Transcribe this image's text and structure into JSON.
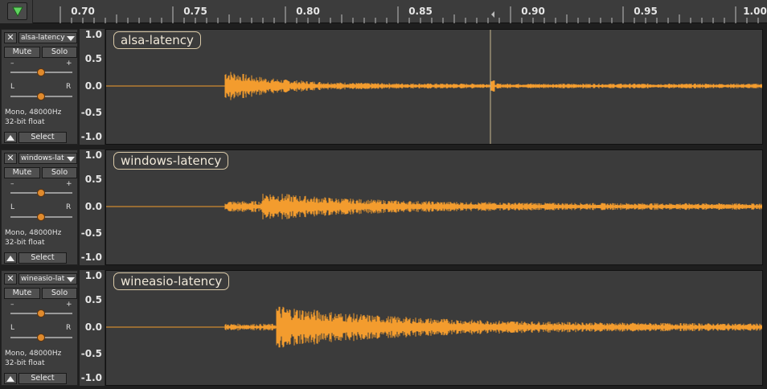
{
  "ruler": {
    "ticks": [
      "0.70",
      "0.75",
      "0.80",
      "0.85",
      "0.90",
      "0.95",
      "1.00"
    ]
  },
  "play_icon": "play-triangle-down-icon",
  "vertical_scale": [
    "1.0",
    "0.5",
    "0.0",
    "-0.5",
    "-1.0"
  ],
  "colors": {
    "waveform": "#f39c2e",
    "background": "#3b3b3b",
    "label_border": "#d9c9a8"
  },
  "tracks": [
    {
      "name": "alsa-latency",
      "label": "alsa-latency",
      "mute": "Mute",
      "solo": "Solo",
      "gain_minus": "–",
      "gain_plus": "+",
      "pan_left": "L",
      "pan_right": "R",
      "info_line1": "Mono, 48000Hz",
      "info_line2": "32-bit float",
      "select": "Select"
    },
    {
      "name": "windows-lat",
      "label": "windows-latency",
      "mute": "Mute",
      "solo": "Solo",
      "gain_minus": "–",
      "gain_plus": "+",
      "pan_left": "L",
      "pan_right": "R",
      "info_line1": "Mono, 48000Hz",
      "info_line2": "32-bit float",
      "select": "Select"
    },
    {
      "name": "wineasio-lat",
      "label": "wineasio-latency",
      "mute": "Mute",
      "solo": "Solo",
      "gain_minus": "–",
      "gain_plus": "+",
      "pan_left": "L",
      "pan_right": "R",
      "info_line1": "Mono, 48000Hz",
      "info_line2": "32-bit float",
      "select": "Select"
    }
  ]
}
